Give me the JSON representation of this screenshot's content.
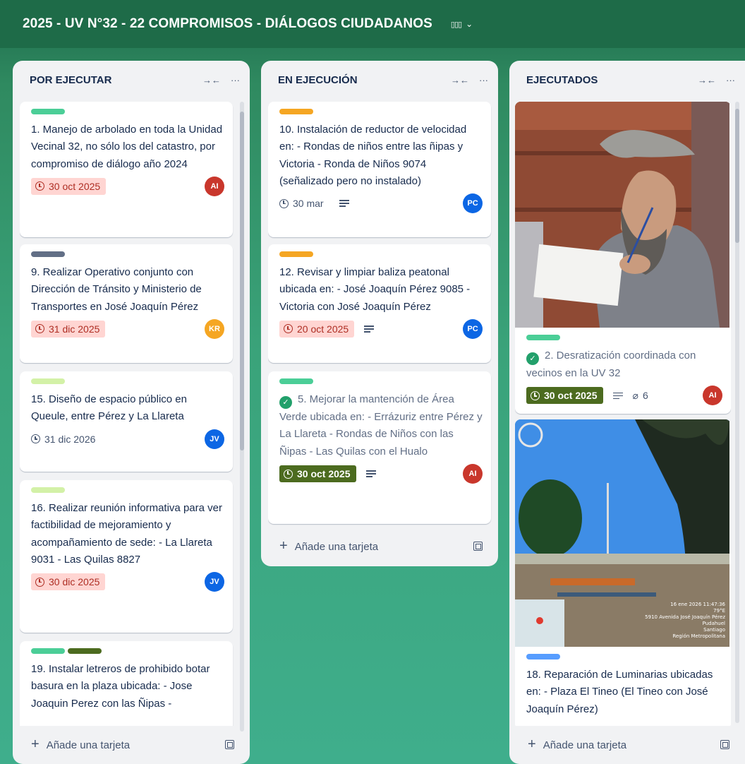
{
  "board": {
    "title": "2025 - UV N°32 - 22 COMPROMISOS - DIÁLOGOS CIUDADANOS",
    "view_icon": "table-view-icon",
    "view_glyph": "▯▯▯"
  },
  "colors": {
    "green": "#4bce97",
    "gray": "#626f86",
    "lime": "#d3f1a7",
    "olive": "#4c6b1f",
    "orange": "#f5a623",
    "blue": "#579dff",
    "red_avatar": "#c9372c",
    "blue_avatar": "#0c66e4",
    "orange_avatar": "#f5a623",
    "darkblue_avatar": "#1f4fb8"
  },
  "lists": [
    {
      "title": "POR EJECUTAR",
      "add_label": "Añade una tarjeta",
      "cards": [
        {
          "labels": [
            "green"
          ],
          "text": "1. Manejo de arbolado en toda la Unidad Vecinal 32, no sólo los del catastro, por compromiso de diálogo año 2024",
          "due": "30 oct 2025",
          "due_state": "overdue",
          "avatar": "AI"
        },
        {
          "labels": [
            "gray"
          ],
          "text": "9. Realizar Operativo conjunto con Dirección de Tránsito y Ministerio de Transportes en José Joaquín Pérez",
          "due": "31 dic 2025",
          "due_state": "overdue",
          "avatar": "KR"
        },
        {
          "labels": [
            "lime"
          ],
          "text": "15. Diseño de espacio público en Queule, entre Pérez y La Llareta",
          "due": "31 dic 2026",
          "due_state": "plain",
          "avatar": "JV"
        },
        {
          "labels": [
            "lime"
          ],
          "text": "16. Realizar reunión informativa para ver factibilidad de mejoramiento y acompañamiento de sede: - La Llareta 9031 - Las Quilas 8827",
          "due": "30 dic 2025",
          "due_state": "overdue",
          "avatar": "JV"
        },
        {
          "labels": [
            "green",
            "olive"
          ],
          "text": "19. Instalar letreros de prohibido botar basura en la plaza ubicada: - Jose Joaquin Perez con las Ñipas -"
        }
      ]
    },
    {
      "title": "EN EJECUCIÓN",
      "add_label": "Añade una tarjeta",
      "cards": [
        {
          "labels": [
            "orange"
          ],
          "text": "10. Instalación de reductor de velocidad en: - Rondas de niños entre las ñipas y Victoria - Ronda de Niños 9074 (señalizado pero no instalado)",
          "due": "30 mar",
          "due_state": "plain",
          "avatar": "PC"
        },
        {
          "labels": [
            "orange"
          ],
          "text": "12. Revisar y limpiar baliza peatonal ubicada en: - José Joaquín Pérez 9085 - Victoria con José Joaquín Pérez",
          "due": "20 oct 2025",
          "due_state": "overdue",
          "avatar": "PC"
        },
        {
          "labels": [
            "green"
          ],
          "text": "5. Mejorar la mantención de Área Verde ubicada en: - Errázuriz entre Pérez y La Llareta - Rondas de Niños con las Ñipas - Las Quilas con el Hualo",
          "due": "30 oct 2025",
          "due_state": "complete",
          "avatar": "AI"
        }
      ]
    },
    {
      "title": "EJECUTADOS",
      "add_label": "Añade una tarjeta",
      "cards": [
        {
          "labels": [
            "green"
          ],
          "text": "2. Desratización coordinada con vecinos en la UV 32",
          "due": "30 oct 2025",
          "due_state": "complete",
          "attachments": "6",
          "avatar": "AI",
          "cover": "photo-man-writing"
        },
        {
          "labels": [
            "blue"
          ],
          "text": "18. Reparación de Luminarias ubicadas en: - Plaza El Tineo (El Tineo con José Joaquín Pérez)",
          "cover": "photo-plaza",
          "photo_stamp": [
            "16 ene 2026 11:47:36",
            "79°E",
            "5910 Avenida José Joaquín Pérez",
            "Pudahuel",
            "Santiago",
            "Región Metropolitana"
          ]
        }
      ]
    }
  ]
}
